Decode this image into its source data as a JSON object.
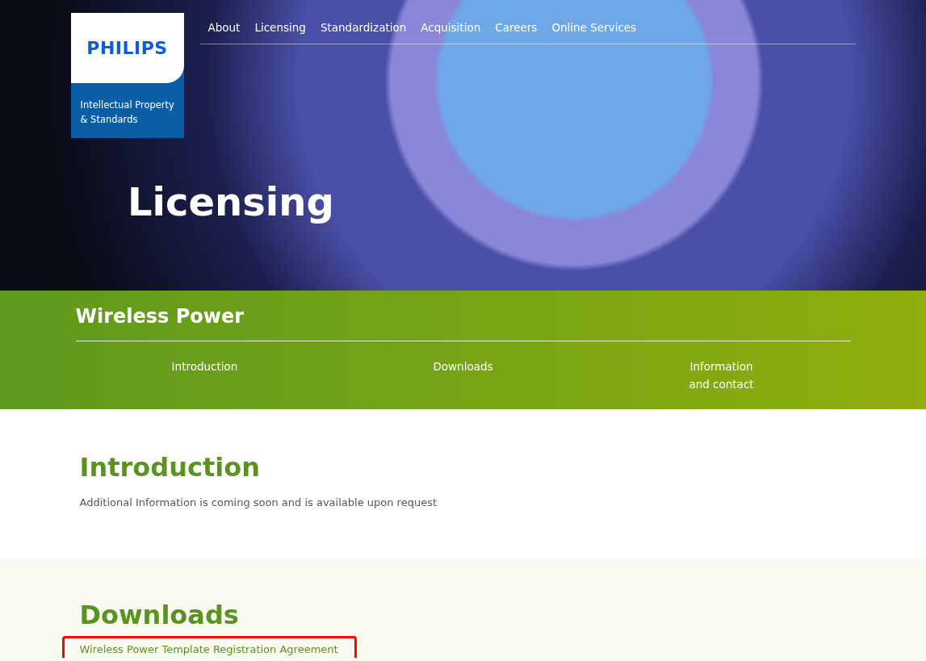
{
  "logo": {
    "brand": "PHILIPS",
    "subtitle_lines": [
      "Intellectual Property",
      "& Standards"
    ]
  },
  "nav": [
    {
      "label": "About"
    },
    {
      "label": "Licensing"
    },
    {
      "label": "Standardization"
    },
    {
      "label": "Acquisition"
    },
    {
      "label": "Careers"
    },
    {
      "label": "Online Services"
    }
  ],
  "hero": {
    "title": "Licensing"
  },
  "section_bar": {
    "title": "Wireless Power",
    "tabs": [
      {
        "lines": [
          "Introduction"
        ]
      },
      {
        "lines": [
          "Downloads"
        ]
      },
      {
        "lines": [
          "Information",
          "and contact"
        ]
      }
    ]
  },
  "introduction": {
    "heading": "Introduction",
    "text": "Additional Information is coming soon and is available upon request"
  },
  "downloads": {
    "heading": "Downloads",
    "links": [
      {
        "label": "Wireless Power Template Registration Agreement",
        "highlighted": true
      }
    ]
  }
}
